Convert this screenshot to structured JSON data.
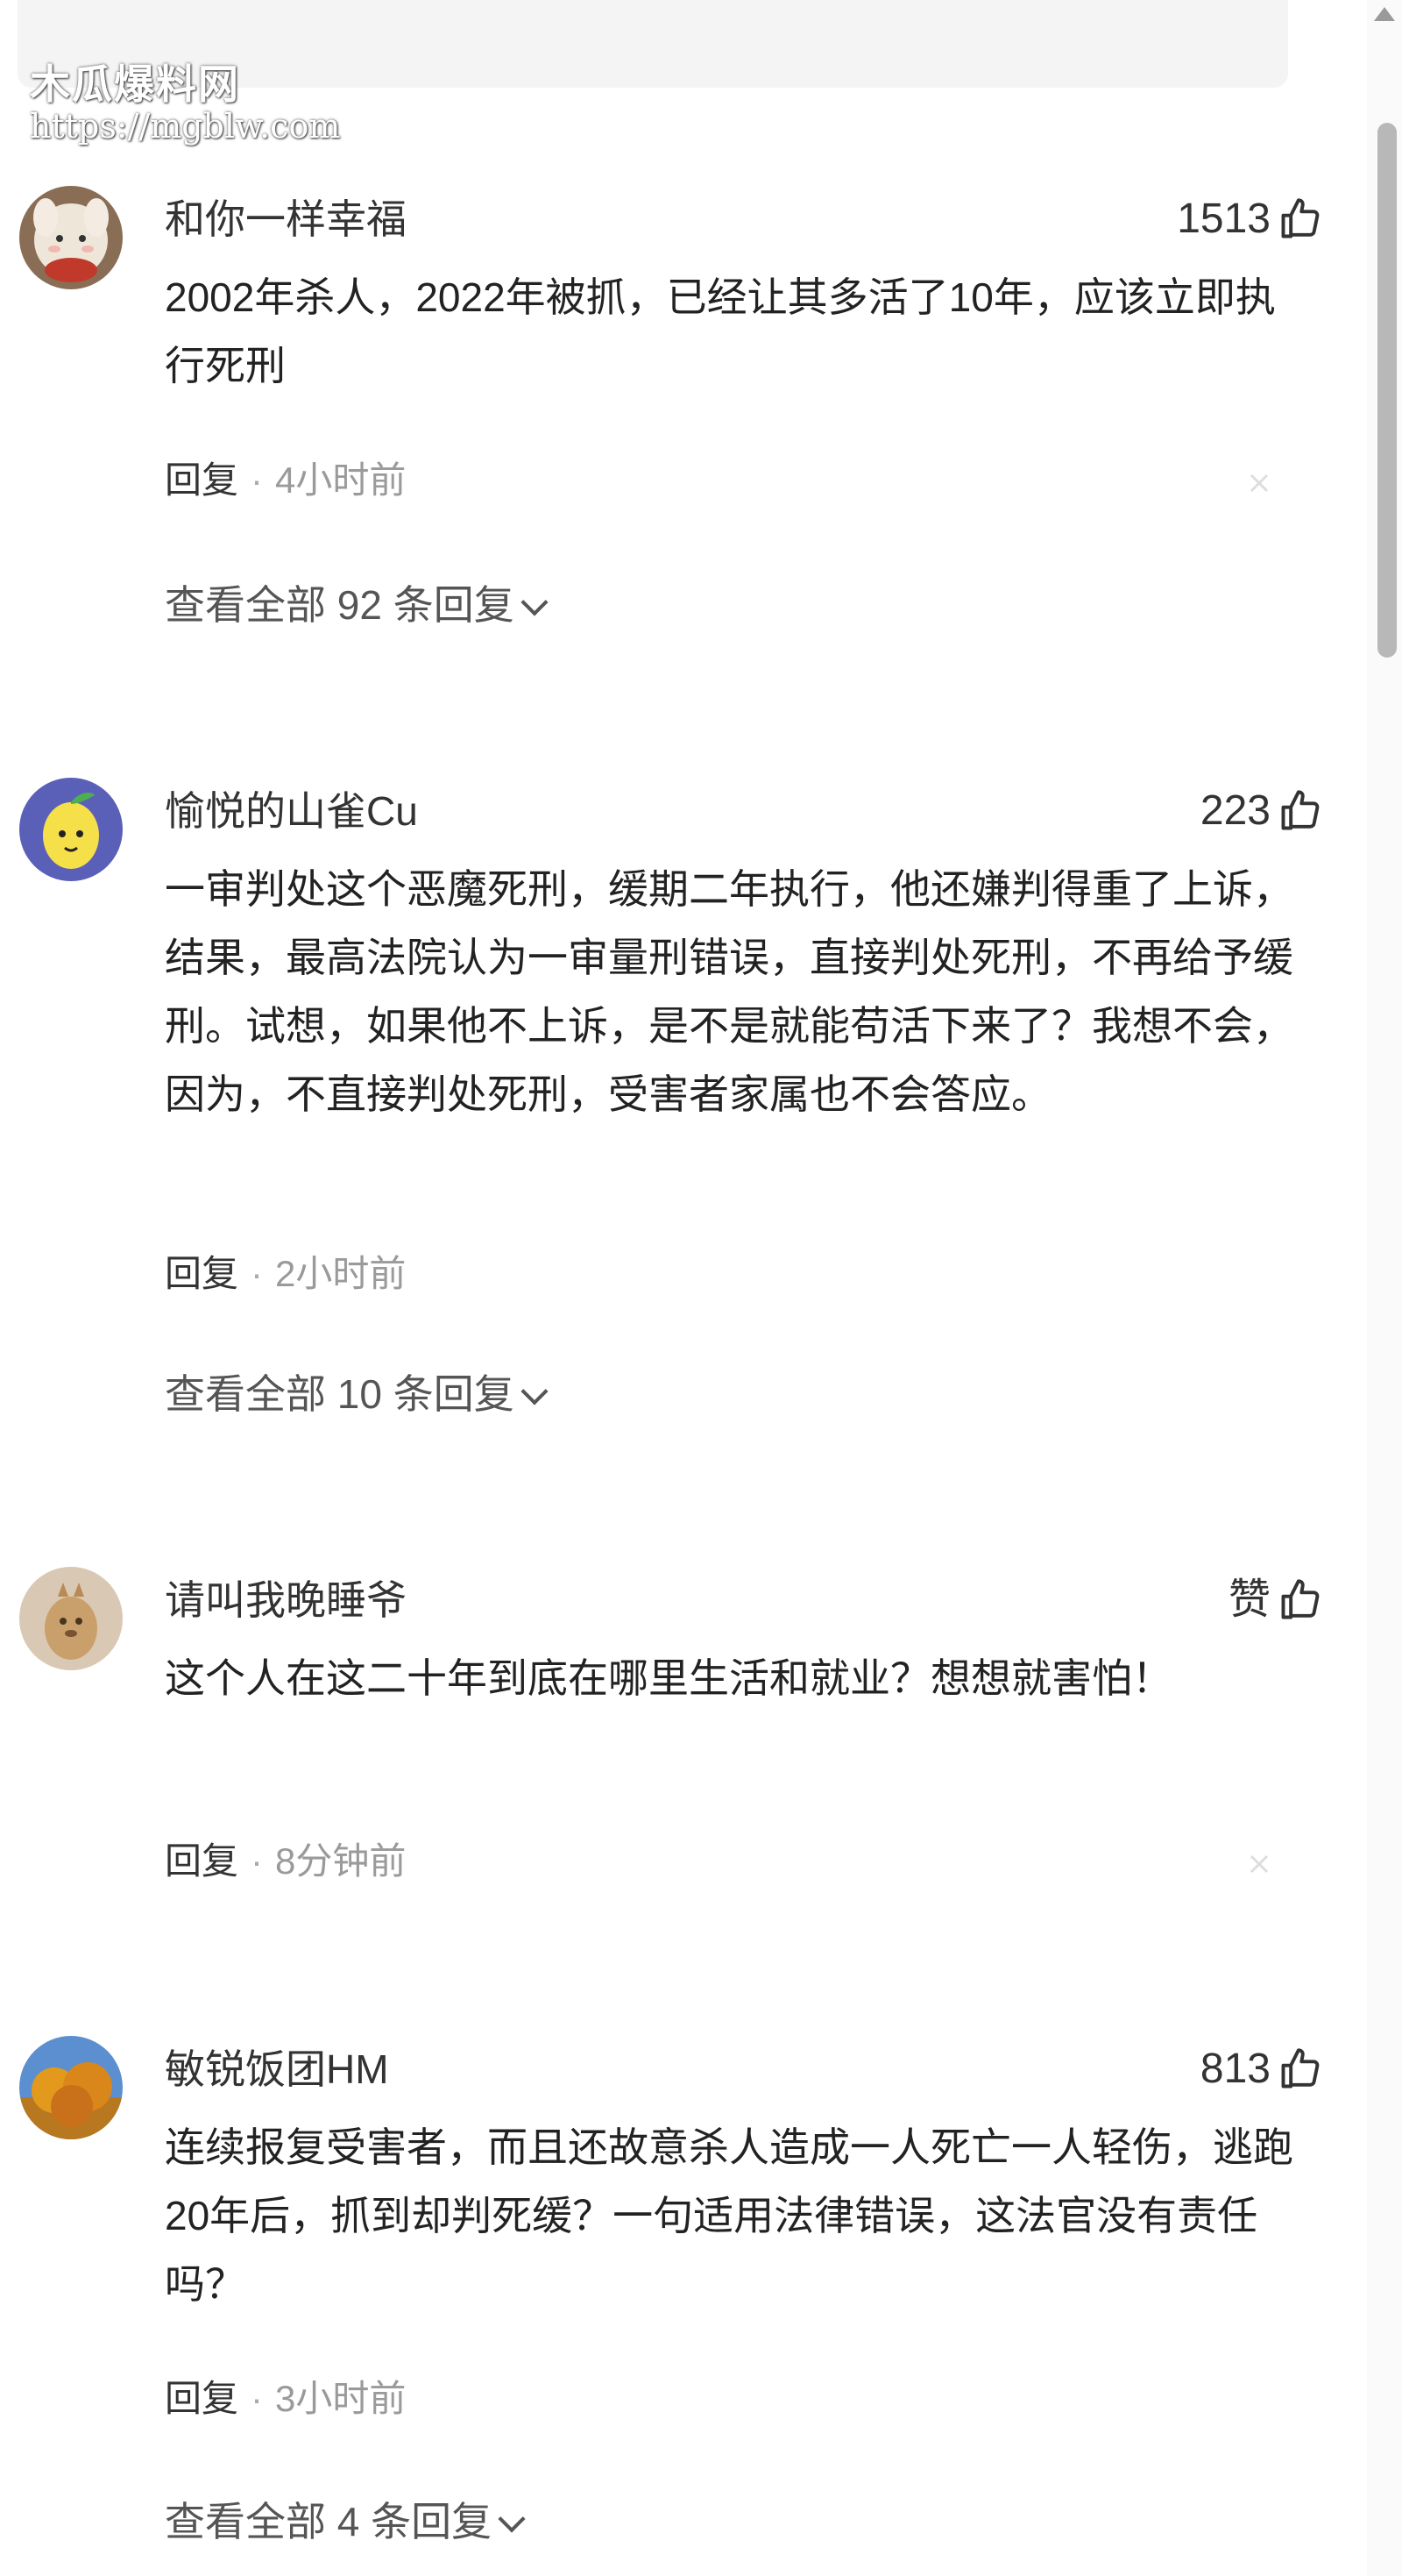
{
  "watermark": {
    "title": "木瓜爆料网",
    "url": "https://mgblw.com"
  },
  "comments": [
    {
      "username": "和你一样幸福",
      "likes": "1513",
      "content": "2002年杀人，2022年被抓，已经让其多活了10年，应该立即执行死刑",
      "reply_label": "回复",
      "separator": "·",
      "time": "4小时前",
      "view_replies": "查看全部 92 条回复",
      "avatar_icon": "plush-doll-avatar-icon"
    },
    {
      "username": "愉悦的山雀Cu",
      "likes": "223",
      "content": "一审判处这个恶魔死刑，缓期二年执行，他还嫌判得重了上诉，结果，最高法院认为一审量刑错误，直接判处死刑，不再给予缓刑。试想，如果他不上诉，是不是就能苟活下来了？我想不会，因为，不直接判处死刑，受害者家属也不会答应。",
      "reply_label": "回复",
      "separator": "·",
      "time": "2小时前",
      "view_replies": "查看全部 10 条回复",
      "avatar_icon": "lemon-character-avatar-icon"
    },
    {
      "username": "请叫我晚睡爷",
      "likes": "赞",
      "content": "这个人在这二十年到底在哪里生活和就业？想想就害怕！",
      "reply_label": "回复",
      "separator": "·",
      "time": "8分钟前",
      "avatar_icon": "cartoon-animal-avatar-icon"
    },
    {
      "username": "敏锐饭团HM",
      "likes": "813",
      "content": "连续报复受害者，而且还故意杀人造成一人死亡一人轻伤，逃跑20年后，抓到却判死缓？一句适用法律错误，这法官没有责任吗？",
      "reply_label": "回复",
      "separator": "·",
      "time": "3小时前",
      "view_replies": "查看全部 4 条回复",
      "avatar_icon": "autumn-tree-avatar-icon"
    }
  ],
  "colors": {
    "text": "#222222",
    "muted": "#9a9a9a",
    "link": "#555555",
    "background": "#ffffff"
  }
}
